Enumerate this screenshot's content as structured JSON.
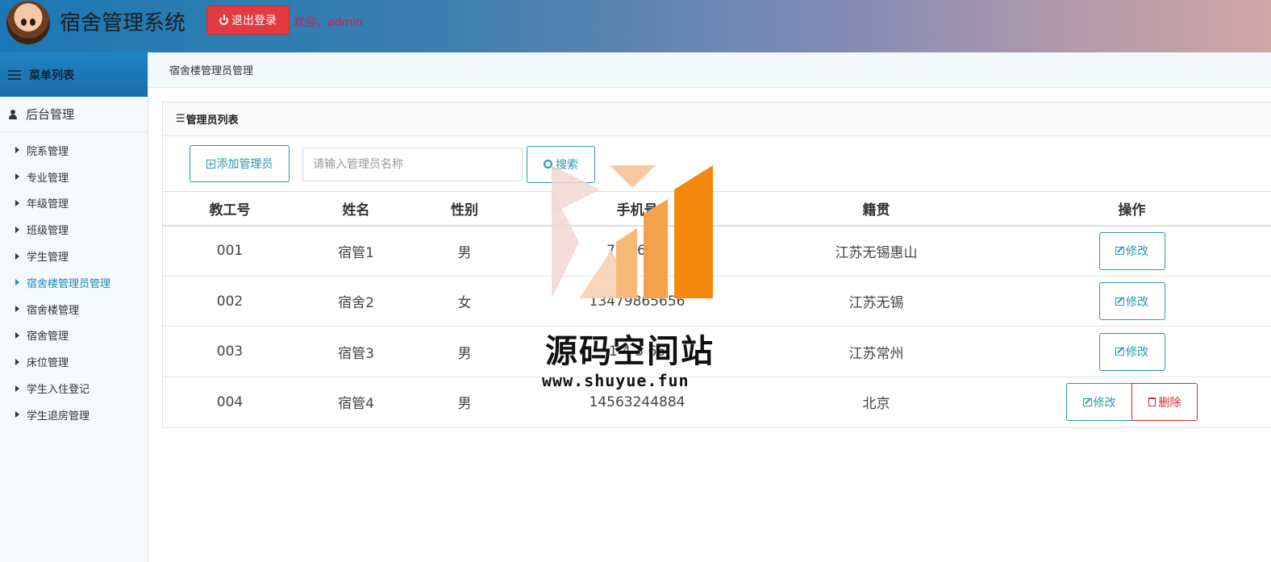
{
  "header": {
    "app_title": "宿舍管理系统",
    "logout_label": "退出登录",
    "welcome_text": "欢迎，admin"
  },
  "sidebar": {
    "menu_title": "菜单列表",
    "section_title": "后台管理",
    "items": [
      {
        "label": "院系管理"
      },
      {
        "label": "专业管理"
      },
      {
        "label": "年级管理"
      },
      {
        "label": "班级管理"
      },
      {
        "label": "学生管理"
      },
      {
        "label": "宿舍楼管理员管理",
        "active": true
      },
      {
        "label": "宿舍楼管理"
      },
      {
        "label": "宿舍管理"
      },
      {
        "label": "床位管理"
      },
      {
        "label": "学生入住登记"
      },
      {
        "label": "学生退房管理"
      }
    ]
  },
  "breadcrumb": "宿舍楼管理员管理",
  "panel": {
    "title": "管理员列表",
    "add_label": "添加管理员",
    "search_placeholder": "请输入管理员名称",
    "search_label": "搜索"
  },
  "table": {
    "headers": [
      "教工号",
      "姓名",
      "性别",
      "手机号",
      "籍贯",
      "操作"
    ],
    "rows": [
      {
        "id": "001",
        "name": "宿管1",
        "gender": "男",
        "phone": "712 66 6",
        "origin": "江苏无锡惠山"
      },
      {
        "id": "002",
        "name": "宿舍2",
        "gender": "女",
        "phone": "13479865656",
        "origin": "江苏无锡"
      },
      {
        "id": "003",
        "name": "宿管3",
        "gender": "男",
        "phone": "1 4 3 66",
        "origin": "江苏常州"
      },
      {
        "id": "004",
        "name": "宿管4",
        "gender": "男",
        "phone": "14563244884",
        "origin": "北京"
      }
    ],
    "edit_label": "修改",
    "delete_label": "删除"
  },
  "watermark": {
    "name": "源码空间站",
    "url": "www.shuyue.fun"
  },
  "colors": {
    "primary": "#2a95b3",
    "danger": "#e23a3e",
    "active_nav": "#1b8ab7",
    "watermark_orange": "#f5890e"
  },
  "icons": [
    "power-icon",
    "bars-icon",
    "user-icon",
    "triangle-right-icon",
    "plus-square-icon",
    "search-icon",
    "edit-icon",
    "trash-icon"
  ]
}
